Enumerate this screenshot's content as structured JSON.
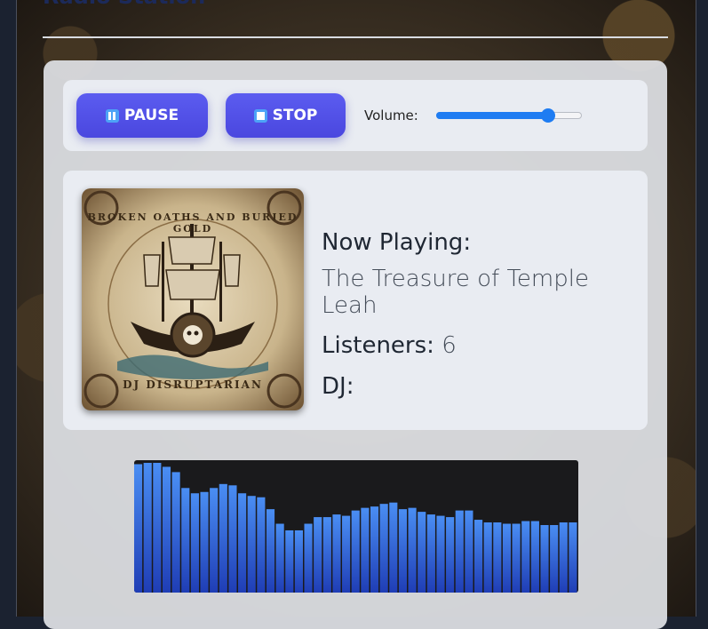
{
  "header": {
    "title": "Radio Station"
  },
  "controls": {
    "pause_label": "PAUSE",
    "stop_label": "STOP",
    "volume_label": "Volume:",
    "volume_level": 0.77
  },
  "now_playing": {
    "label": "Now Playing:",
    "track_title": "The Treasure of Temple Leah",
    "listeners_label": "Listeners:",
    "listeners_count": "6",
    "dj_label": "DJ:",
    "dj_name": ""
  },
  "album_art": {
    "top_text": "BROKEN OATHS AND BURIED GOLD",
    "bottom_text": "DJ DISRUPTARIAN"
  },
  "visualizer": {
    "bar_levels": [
      0.97,
      0.98,
      0.98,
      0.95,
      0.91,
      0.79,
      0.75,
      0.76,
      0.79,
      0.82,
      0.81,
      0.75,
      0.73,
      0.72,
      0.63,
      0.52,
      0.47,
      0.47,
      0.52,
      0.57,
      0.57,
      0.59,
      0.58,
      0.62,
      0.64,
      0.65,
      0.67,
      0.68,
      0.63,
      0.64,
      0.61,
      0.59,
      0.58,
      0.57,
      0.62,
      0.62,
      0.55,
      0.53,
      0.53,
      0.52,
      0.52,
      0.54,
      0.54,
      0.51,
      0.51,
      0.53,
      0.53
    ],
    "colors": {
      "top": "#4a8ef3",
      "bottom": "#1f3db5",
      "background": "#1a1a1c"
    }
  },
  "colors": {
    "accent": "#4f4ee6",
    "slider": "#1e7cf2",
    "panel": "#e9ecf2"
  }
}
